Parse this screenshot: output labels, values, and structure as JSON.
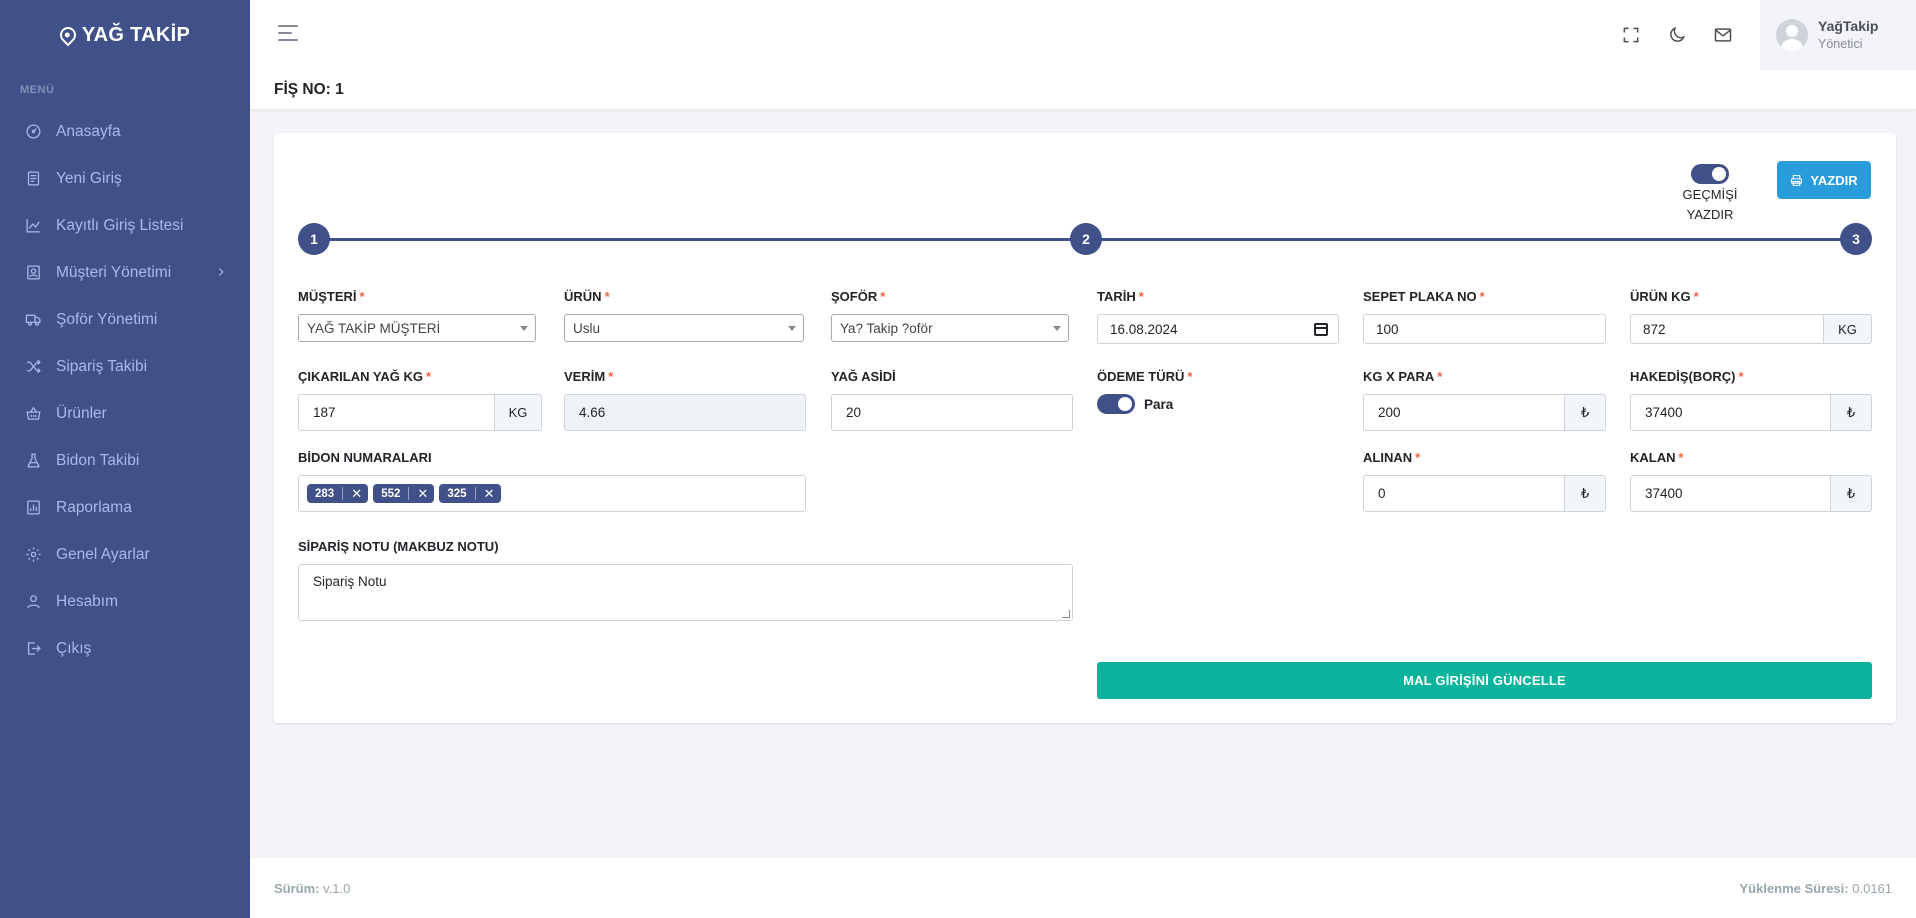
{
  "brand": {
    "name": "YAĞ TAKİP"
  },
  "sidebar": {
    "menu_title": "MENÜ",
    "items": [
      {
        "label": "Anasayfa",
        "icon": "dashboard-icon"
      },
      {
        "label": "Yeni Giriş",
        "icon": "document-icon"
      },
      {
        "label": "Kayıtlı Giriş Listesi",
        "icon": "line-chart-icon"
      },
      {
        "label": "Müşteri Yönetimi",
        "icon": "contacts-icon"
      },
      {
        "label": "Şoför Yönetimi",
        "icon": "truck-icon"
      },
      {
        "label": "Sipariş Takibi",
        "icon": "shuffle-icon"
      },
      {
        "label": "Ürünler",
        "icon": "basket-icon"
      },
      {
        "label": "Bidon Takibi",
        "icon": "flask-icon"
      },
      {
        "label": "Raporlama",
        "icon": "report-icon"
      },
      {
        "label": "Genel Ayarlar",
        "icon": "gear-icon"
      },
      {
        "label": "Hesabım",
        "icon": "user-icon"
      },
      {
        "label": "Çıkış",
        "icon": "logout-icon"
      }
    ]
  },
  "topbar": {
    "user_name": "YağTakip",
    "user_role": "Yönetici"
  },
  "page": {
    "title": "FİŞ NO: 1"
  },
  "print": {
    "history_label_1": "GEÇMİŞİ",
    "history_label_2": "YAZDIR",
    "button_label": "YAZDIR"
  },
  "stepper": [
    "1",
    "2",
    "3"
  ],
  "form": {
    "musteri": {
      "label": "MÜŞTERİ",
      "value": "YAĞ TAKİP MÜŞTERİ"
    },
    "urun": {
      "label": "ÜRÜN",
      "value": "Uslu"
    },
    "sofor": {
      "label": "ŞOFÖR",
      "value": "Ya? Takip ?oför"
    },
    "tarih": {
      "label": "TARİH",
      "value": "16.08.2024"
    },
    "sepet_plaka": {
      "label": "SEPET PLAKA NO",
      "value": "100"
    },
    "urun_kg": {
      "label": "ÜRÜN KG",
      "value": "872",
      "unit": "KG"
    },
    "cikarilan_yag": {
      "label": "ÇIKARILAN YAĞ KG",
      "value": "187",
      "unit": "KG"
    },
    "verim": {
      "label": "VERİM",
      "value": "4.66"
    },
    "yag_asidi": {
      "label": "YAĞ ASİDİ",
      "value": "20"
    },
    "odeme_turu": {
      "label": "ÖDEME TÜRÜ",
      "value": "Para"
    },
    "kg_x_para": {
      "label": "KG X PARA",
      "value": "200",
      "unit": "₺"
    },
    "hakedis": {
      "label": "HAKEDİŞ(BORÇ)",
      "value": "37400",
      "unit": "₺"
    },
    "bidon": {
      "label": "BİDON NUMARALARI",
      "tags": [
        "283",
        "552",
        "325"
      ]
    },
    "alinan": {
      "label": "ALINAN",
      "value": "0",
      "unit": "₺"
    },
    "kalan": {
      "label": "KALAN",
      "value": "37400",
      "unit": "₺"
    },
    "siparis_notu": {
      "label": "SİPARİŞ NOTU (MAKBUZ NOTU)",
      "value": "Sipariş Notu"
    },
    "required_mark": "*",
    "submit_label": "MAL GİRİŞİNİ GÜNCELLE"
  },
  "footer": {
    "version_label": "Sürüm:",
    "version_value": "v.1.0",
    "load_label": "Yüklenme Süresi:",
    "load_value": "0.0161"
  },
  "colors": {
    "primary": "#405189",
    "success": "#0ab39c",
    "info": "#299cdb",
    "required": "#f06548"
  }
}
